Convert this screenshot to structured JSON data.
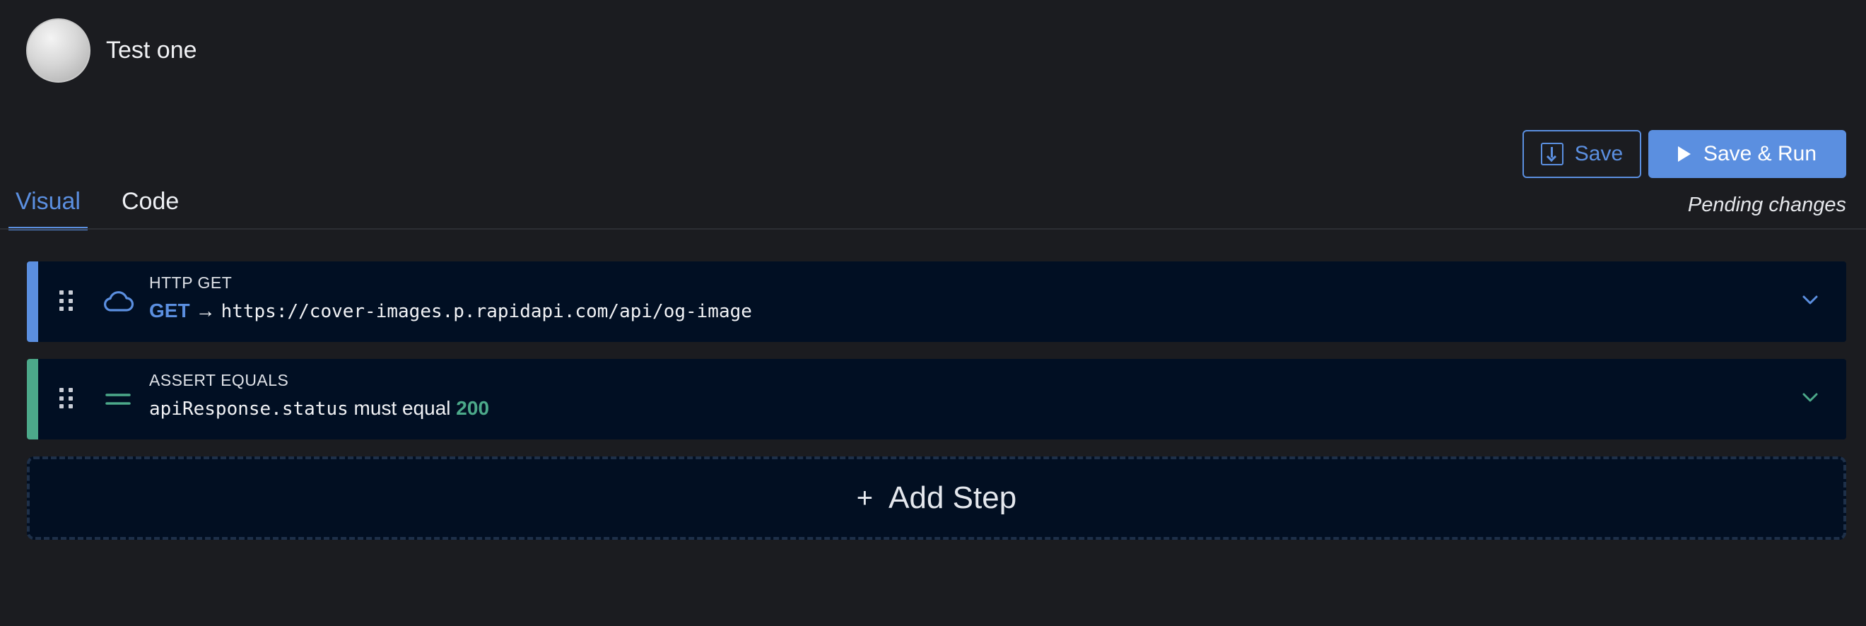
{
  "test": {
    "name": "Test one"
  },
  "toolbar": {
    "save_label": "Save",
    "save_run_label": "Save & Run",
    "status": "Pending changes"
  },
  "tabs": [
    {
      "label": "Visual",
      "active": true
    },
    {
      "label": "Code",
      "active": false
    }
  ],
  "steps": [
    {
      "kind": "HTTP GET",
      "method": "GET",
      "arrow": "→",
      "url": "https://cover-images.p.rapidapi.com/api/og-image",
      "accent": "#5b8fe0",
      "icon": "cloud-icon"
    },
    {
      "kind": "ASSERT EQUALS",
      "subject": "apiResponse.status",
      "operator": "must equal",
      "expected": "200",
      "accent": "#4ca98a",
      "icon": "equals-icon"
    }
  ],
  "add_step": {
    "plus": "+",
    "label": "Add Step"
  },
  "colors": {
    "accent_blue": "#5b8fe0",
    "accent_green": "#4ca98a",
    "background": "#1b1c20",
    "card": "#010f23"
  }
}
